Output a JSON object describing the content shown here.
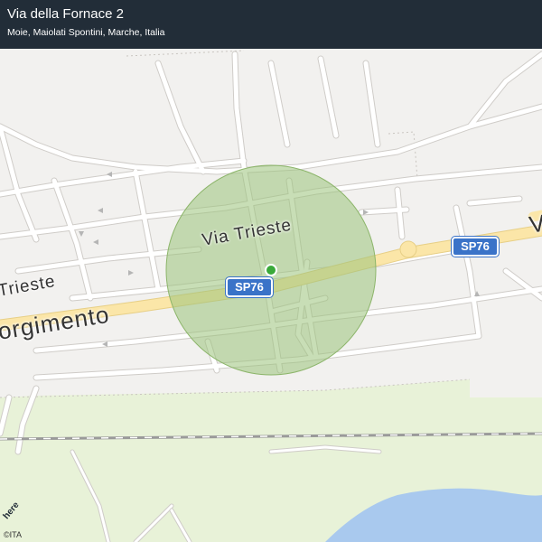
{
  "header": {
    "title": "Via della Fornace 2",
    "subtitle": "Moie, Maiolati Spontini, Marche, Italia"
  },
  "map": {
    "road_labels": {
      "via_trieste_main": "Via Trieste",
      "via_trieste_left": "Trieste",
      "risorgimento": "orgimento"
    },
    "shields": [
      "SP76",
      "SP76"
    ],
    "logo": "here",
    "copyright": "©ITA",
    "colors": {
      "land": "#e8f2d8",
      "urban": "#f2f1ef",
      "road": "#ffffff",
      "main_road": "#fbe6a8",
      "water": "#a9c9ee",
      "accuracy_circle": "#9bc27a",
      "location_dot": "#3aaa3a"
    }
  }
}
